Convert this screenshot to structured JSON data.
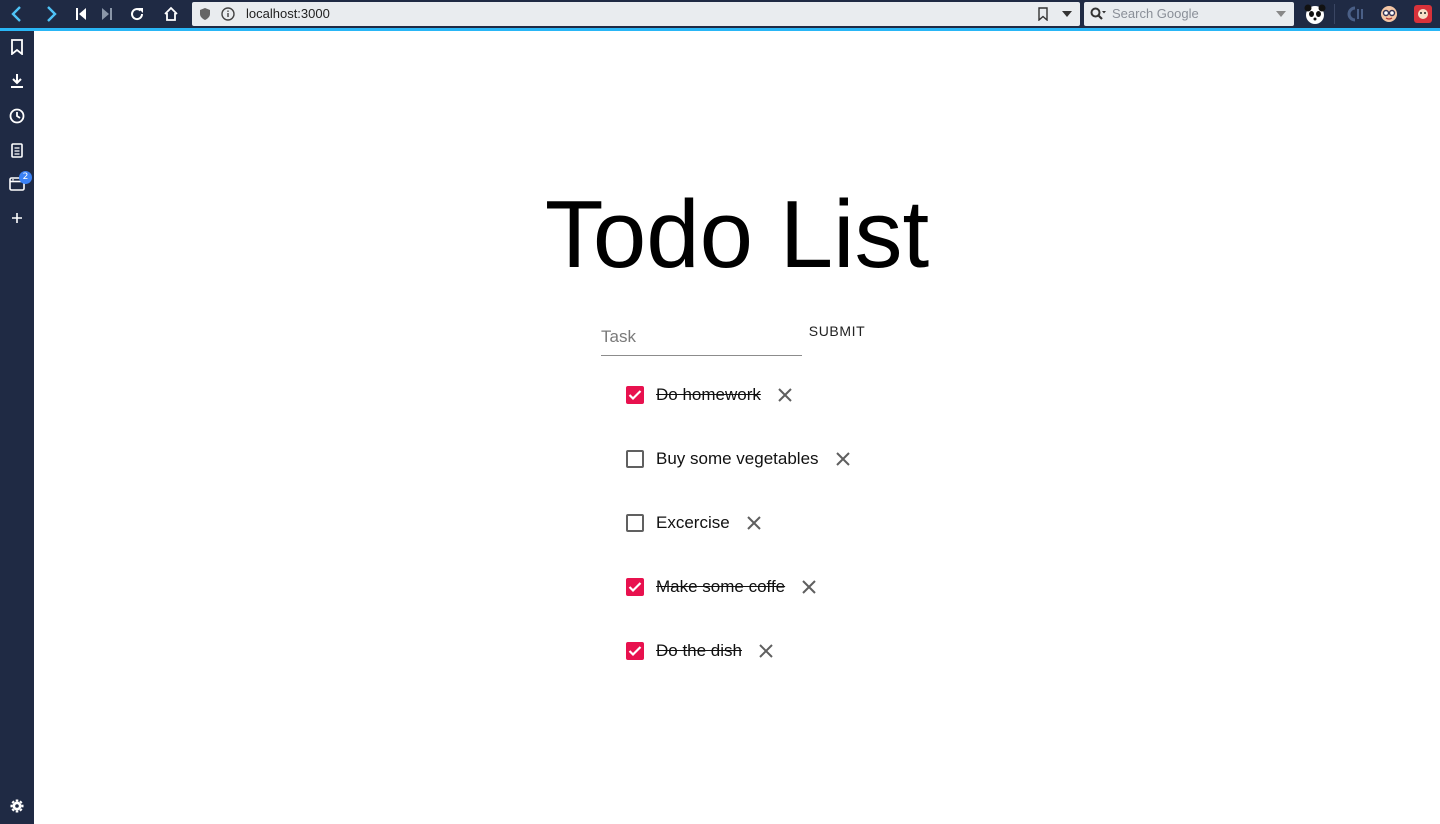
{
  "browser": {
    "url": "localhost:3000",
    "search_placeholder": "Search Google"
  },
  "sidebar": {
    "items": [
      {
        "icon": "bookmark-icon"
      },
      {
        "icon": "download-icon"
      },
      {
        "icon": "history-icon"
      },
      {
        "icon": "notes-icon"
      },
      {
        "icon": "window-icon",
        "badge": "2"
      },
      {
        "icon": "plus-icon"
      }
    ],
    "settings_icon": "gear-icon"
  },
  "page": {
    "title": "Todo List",
    "task_placeholder": "Task",
    "task_value": "",
    "submit_label": "SUBMIT",
    "accent_color": "#e8114e",
    "todos": [
      {
        "text": "Do homework",
        "done": true
      },
      {
        "text": "Buy some vegetables",
        "done": false
      },
      {
        "text": "Excercise",
        "done": false
      },
      {
        "text": "Make some coffe",
        "done": true
      },
      {
        "text": "Do the dish",
        "done": true
      }
    ]
  }
}
